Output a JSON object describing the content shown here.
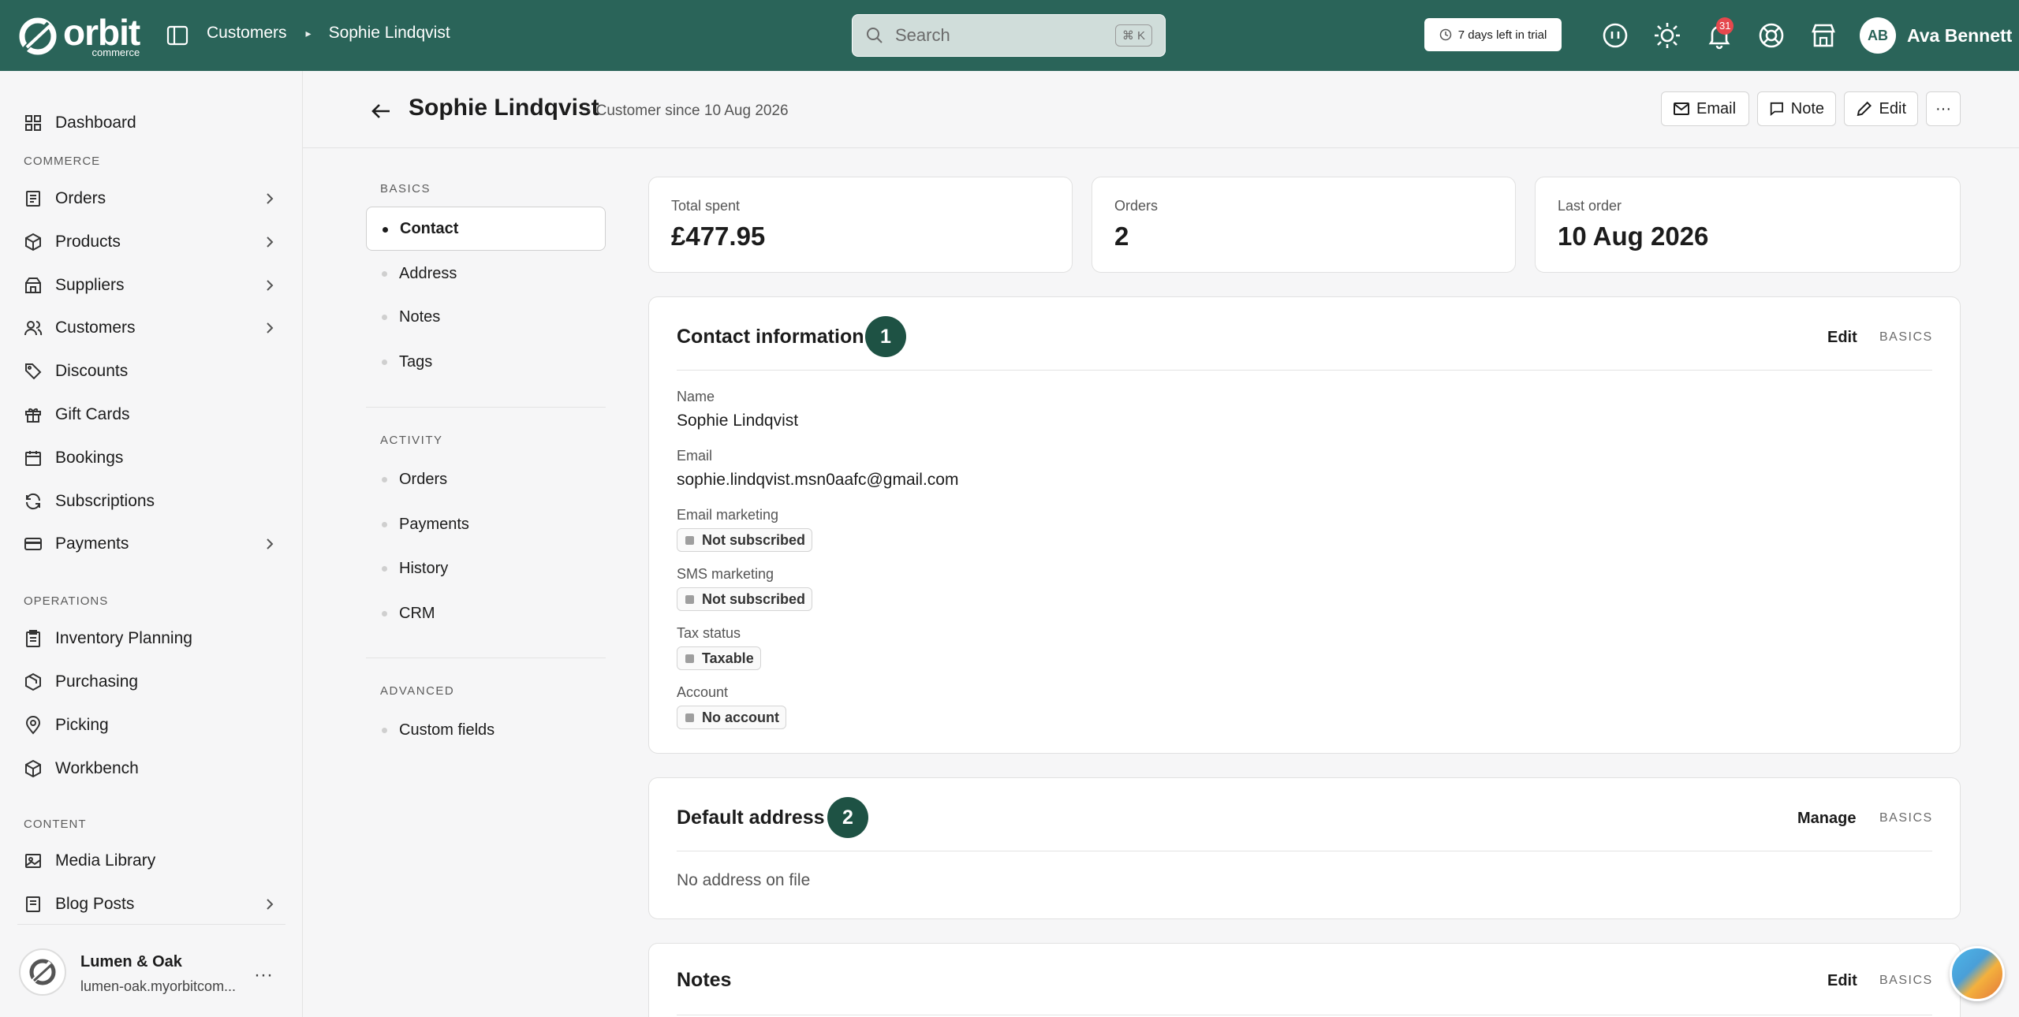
{
  "brand": {
    "name": "orbit",
    "sub": "commerce"
  },
  "breadcrumb": {
    "parent": "Customers",
    "current": "Sophie Lindqvist"
  },
  "search": {
    "placeholder": "Search",
    "shortcut": "⌘ K"
  },
  "trial": {
    "label": "7 days left in trial"
  },
  "notifications": {
    "count": "31"
  },
  "user": {
    "initials": "AB",
    "name": "Ava Bennett"
  },
  "sidebar": {
    "top": {
      "label": "Dashboard",
      "icon": "dashboard-icon"
    },
    "sections": [
      {
        "title": "COMMERCE",
        "items": [
          {
            "label": "Orders",
            "icon": "orders-icon",
            "expandable": true
          },
          {
            "label": "Products",
            "icon": "products-icon",
            "expandable": true
          },
          {
            "label": "Suppliers",
            "icon": "suppliers-icon",
            "expandable": true
          },
          {
            "label": "Customers",
            "icon": "customers-icon",
            "expandable": true
          },
          {
            "label": "Discounts",
            "icon": "discounts-icon",
            "expandable": false
          },
          {
            "label": "Gift Cards",
            "icon": "gift-icon",
            "expandable": false
          },
          {
            "label": "Bookings",
            "icon": "calendar-icon",
            "expandable": false
          },
          {
            "label": "Subscriptions",
            "icon": "refresh-icon",
            "expandable": false
          },
          {
            "label": "Payments",
            "icon": "card-icon",
            "expandable": true
          }
        ]
      },
      {
        "title": "OPERATIONS",
        "items": [
          {
            "label": "Inventory Planning",
            "icon": "clipboard-icon"
          },
          {
            "label": "Purchasing",
            "icon": "purchasing-icon"
          },
          {
            "label": "Picking",
            "icon": "pin-icon"
          },
          {
            "label": "Workbench",
            "icon": "cube-icon"
          }
        ]
      },
      {
        "title": "CONTENT",
        "items": [
          {
            "label": "Media Library",
            "icon": "image-icon"
          },
          {
            "label": "Blog Posts",
            "icon": "blog-icon",
            "expandable": true
          }
        ]
      }
    ],
    "store": {
      "name": "Lumen & Oak",
      "url": "lumen-oak.myorbitcom..."
    }
  },
  "page": {
    "title": "Sophie Lindqvist",
    "subtitle": "· Customer since 10 Aug 2026",
    "actions": {
      "email": "Email",
      "note": "Note",
      "edit": "Edit",
      "more": "···"
    }
  },
  "section_nav": {
    "groups": [
      {
        "title": "BASICS",
        "items": [
          "Contact",
          "Address",
          "Notes",
          "Tags"
        ]
      },
      {
        "title": "ACTIVITY",
        "items": [
          "Orders",
          "Payments",
          "History",
          "CRM"
        ]
      },
      {
        "title": "ADVANCED",
        "items": [
          "Custom fields"
        ]
      }
    ],
    "active": "Contact"
  },
  "stats": [
    {
      "label": "Total spent",
      "value": "£477.95"
    },
    {
      "label": "Orders",
      "value": "2"
    },
    {
      "label": "Last order",
      "value": "10 Aug 2026"
    }
  ],
  "contact": {
    "title": "Contact information",
    "step": "1",
    "action": "Edit",
    "tag": "BASICS",
    "name_label": "Name",
    "name": "Sophie Lindqvist",
    "email_label": "Email",
    "email": "sophie.lindqvist.msn0aafc@gmail.com",
    "email_marketing_label": "Email marketing",
    "email_marketing": "Not subscribed",
    "sms_marketing_label": "SMS marketing",
    "sms_marketing": "Not subscribed",
    "tax_label": "Tax status",
    "tax": "Taxable",
    "account_label": "Account",
    "account": "No account"
  },
  "address": {
    "title": "Default address",
    "step": "2",
    "action": "Manage",
    "tag": "BASICS",
    "empty": "No address on file"
  },
  "notes": {
    "title": "Notes",
    "action": "Edit",
    "tag": "BASICS"
  }
}
